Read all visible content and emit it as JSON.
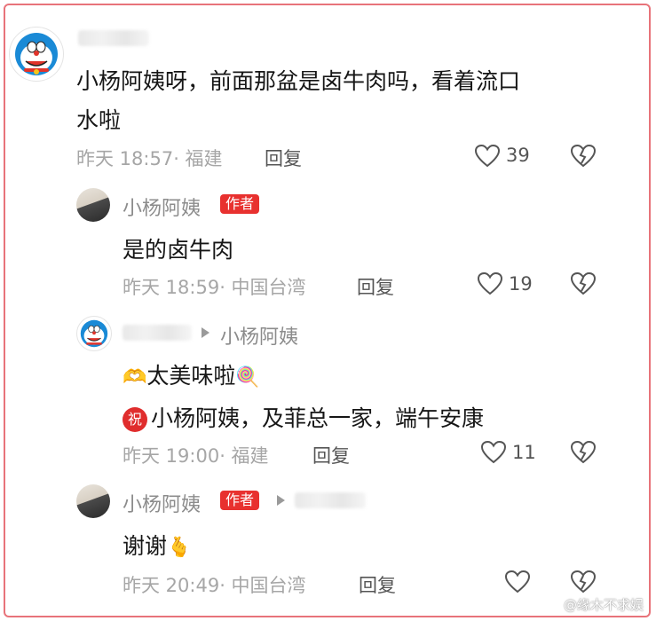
{
  "comments": [
    {
      "content_line1": "小杨阿姨呀，前面那盆是卤牛肉吗，看着流口",
      "content_line2": "水啦",
      "meta": "昨天 18:57· 福建",
      "reply_label": "回复",
      "likes": "39"
    },
    {
      "username": "小杨阿姨",
      "author_tag": "作者",
      "content": "是的卤牛肉",
      "meta": "昨天 18:59· 中国台湾",
      "reply_label": "回复",
      "likes": "19"
    },
    {
      "reply_to": "小杨阿姨",
      "content_line1": "太美味啦",
      "badge": "祝",
      "content_line2": "小杨阿姨，及菲总一家，端午安康",
      "meta": "昨天 19:00· 福建",
      "reply_label": "回复",
      "likes": "11"
    },
    {
      "username": "小杨阿姨",
      "author_tag": "作者",
      "content": "谢谢",
      "meta": "昨天 20:49· 中国台湾",
      "reply_label": "回复"
    }
  ],
  "watermark": "@缘木不求娱",
  "colors": {
    "frame_border": "#e8737a",
    "author_tag": "#e8312f",
    "text": "#161616",
    "muted": "#a6a6a6"
  }
}
